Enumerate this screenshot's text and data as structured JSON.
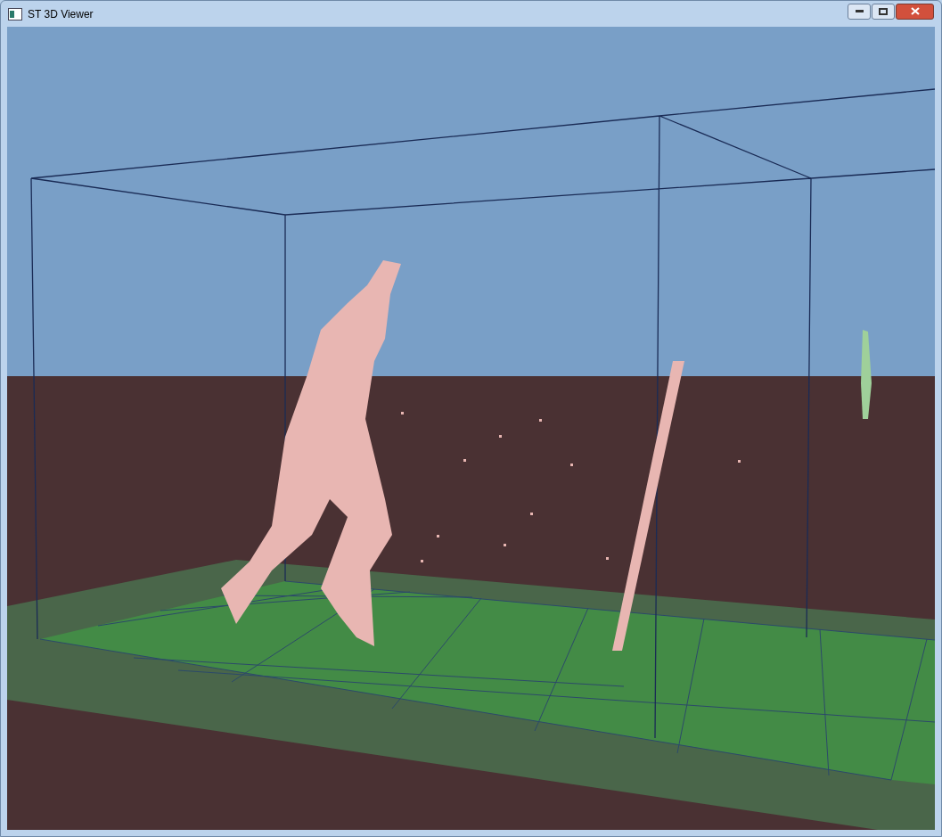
{
  "window": {
    "title": "ST 3D Viewer"
  }
}
